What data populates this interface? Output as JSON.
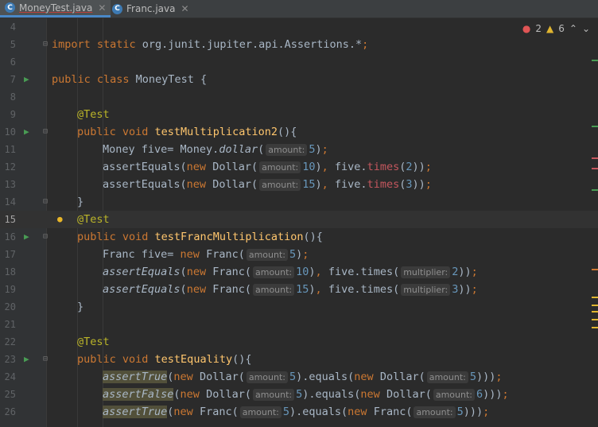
{
  "tabs": [
    {
      "name": "MoneyTest.java",
      "active": true,
      "icon": "java-class-icon"
    },
    {
      "name": "Franc.java",
      "active": false,
      "icon": "java-class-icon"
    }
  ],
  "inspections": {
    "errors": "2",
    "warnings": "6"
  },
  "lines": {
    "l4": "4",
    "l5": "5",
    "l6": "6",
    "l7": "7",
    "l8": "8",
    "l9": "9",
    "l10": "10",
    "l11": "11",
    "l12": "12",
    "l13": "13",
    "l14": "14",
    "l15": "15",
    "l16": "16",
    "l17": "17",
    "l18": "18",
    "l19": "19",
    "l20": "20",
    "l21": "21",
    "l22": "22",
    "l23": "23",
    "l24": "24",
    "l25": "25",
    "l26": "26"
  },
  "code": {
    "import": "import static org.junit.jupiter.api.Assertions.*;",
    "class_decl": "public class MoneyTest {",
    "test_anno": "@Test",
    "m1": "testMultiplication2",
    "m2": "testFrancMultiplication",
    "m3": "testEquality",
    "hint_amount": "amount:",
    "hint_multiplier": "multiplier:"
  },
  "colors": {
    "background": "#2b2b2b",
    "keyword": "#cc7832",
    "annotation": "#bbb529",
    "method": "#ffc66d",
    "number": "#6897bb"
  }
}
